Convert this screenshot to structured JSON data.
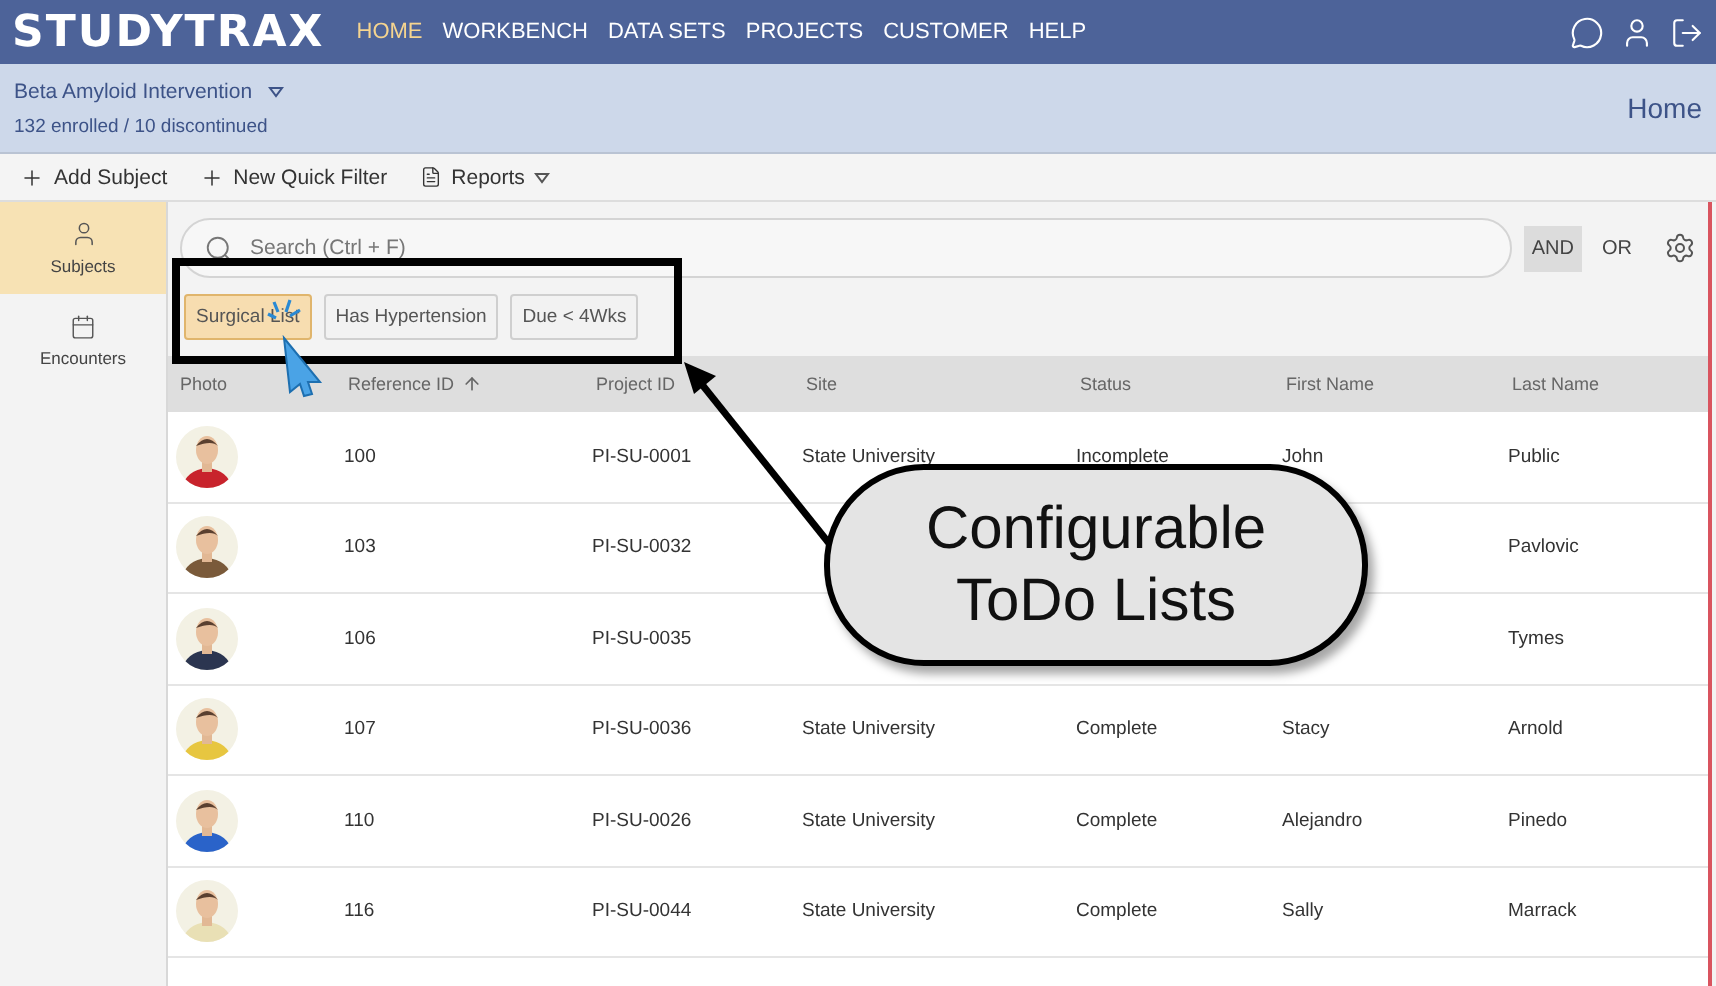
{
  "logo": "STUDYTRAX",
  "nav": [
    {
      "label": "HOME",
      "selected": true
    },
    {
      "label": "WORKBENCH",
      "selected": false
    },
    {
      "label": "DATA SETS",
      "selected": false
    },
    {
      "label": "PROJECTS",
      "selected": false
    },
    {
      "label": "CUSTOMER",
      "selected": false
    },
    {
      "label": "HELP",
      "selected": false
    }
  ],
  "study": {
    "name": "Beta Amyloid Intervention",
    "counts": "132 enrolled / 10 discontinued",
    "page": "Home"
  },
  "toolbar": [
    {
      "label": "Add Subject",
      "kind": "add"
    },
    {
      "label": "New Quick Filter",
      "kind": "add"
    },
    {
      "label": "Reports",
      "kind": "menu"
    }
  ],
  "sidebar": [
    {
      "label": "Subjects",
      "selected": true,
      "kind": "person"
    },
    {
      "label": "Encounters",
      "selected": false,
      "kind": "calendar"
    }
  ],
  "search": {
    "placeholder": "Search (Ctrl + F)"
  },
  "logic": [
    {
      "label": "AND",
      "selected": true
    },
    {
      "label": "OR",
      "selected": false
    }
  ],
  "filters": [
    {
      "label": "Surgical List",
      "selected": true
    },
    {
      "label": "Has Hypertension",
      "selected": false
    },
    {
      "label": "Due < 4Wks",
      "selected": false
    }
  ],
  "table": {
    "columns": [
      {
        "label": "Photo",
        "sorted": false
      },
      {
        "label": "Reference ID",
        "sorted": true
      },
      {
        "label": "Project ID",
        "sorted": false
      },
      {
        "label": "Site",
        "sorted": false
      },
      {
        "label": "Status",
        "sorted": false
      },
      {
        "label": "First Name",
        "sorted": false
      },
      {
        "label": "Last Name",
        "sorted": false
      }
    ],
    "rows": [
      {
        "cells": [
          {
            "kind": "picture"
          },
          "100",
          "PI-SU-0001",
          "State University",
          "Incomplete",
          "John",
          "Public"
        ]
      },
      {
        "cells": [
          {
            "kind": "picture"
          },
          "103",
          "PI-SU-0032",
          null,
          null,
          null,
          "Pavlovic"
        ]
      },
      {
        "cells": [
          {
            "kind": "picture"
          },
          "106",
          "PI-SU-0035",
          null,
          null,
          null,
          "Tymes"
        ]
      },
      {
        "cells": [
          {
            "kind": "picture"
          },
          "107",
          "PI-SU-0036",
          "State University",
          "Complete",
          "Stacy",
          "Arnold"
        ]
      },
      {
        "cells": [
          {
            "kind": "picture"
          },
          "110",
          "PI-SU-0026",
          "State University",
          "Complete",
          "Alejandro",
          "Pinedo"
        ]
      },
      {
        "cells": [
          {
            "kind": "picture"
          },
          "116",
          "PI-SU-0044",
          "State University",
          "Complete",
          "Sally",
          "Marrack"
        ]
      }
    ]
  },
  "callout": {
    "lines": [
      "Configurable",
      "ToDo Lists"
    ]
  }
}
